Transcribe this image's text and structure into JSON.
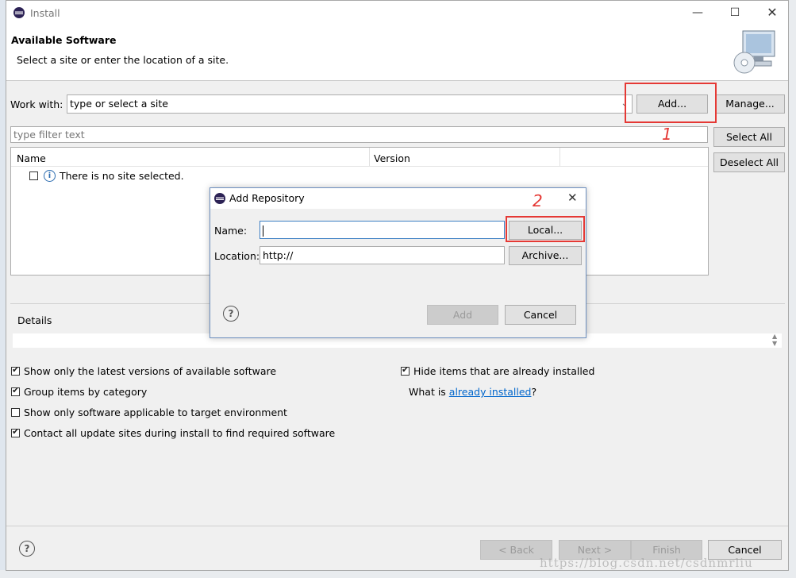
{
  "window": {
    "title": "Install"
  },
  "banner": {
    "title": "Available Software",
    "description": "Select a site or enter the location of a site."
  },
  "work_with": {
    "label": "Work with:",
    "value": "type or select a site",
    "add_button": "Add...",
    "manage_button": "Manage..."
  },
  "filter": {
    "placeholder": "type filter text"
  },
  "side_buttons": {
    "select_all": "Select All",
    "deselect_all": "Deselect All"
  },
  "table": {
    "columns": [
      "Name",
      "Version"
    ],
    "rows": [
      {
        "name": "There is no site selected.",
        "checked": false
      }
    ]
  },
  "details": {
    "label": "Details"
  },
  "options": [
    {
      "label": "Show only the latest versions of available software",
      "checked": true
    },
    {
      "label": "Group items by category",
      "checked": true
    },
    {
      "label": "Show only software applicable to target environment",
      "checked": false
    },
    {
      "label": "Contact all update sites during install to find required software",
      "checked": true
    },
    {
      "label": "Hide items that are already installed",
      "checked": true
    }
  ],
  "what_is": {
    "prefix": "What is ",
    "link": "already installed",
    "suffix": "?"
  },
  "footer": {
    "back": "< Back",
    "next": "Next >",
    "finish": "Finish",
    "cancel": "Cancel"
  },
  "dialog": {
    "title": "Add Repository",
    "name_label": "Name:",
    "name_value": "",
    "location_label": "Location:",
    "location_value": "http://",
    "local_button": "Local...",
    "archive_button": "Archive...",
    "add_button": "Add",
    "cancel_button": "Cancel"
  },
  "annotations": {
    "step1": "1",
    "step2": "2"
  },
  "watermark": "https://blog.csdn.net/csdnmrliu",
  "colors": {
    "annotation_red": "#e53935",
    "link_blue": "#0066cc"
  }
}
